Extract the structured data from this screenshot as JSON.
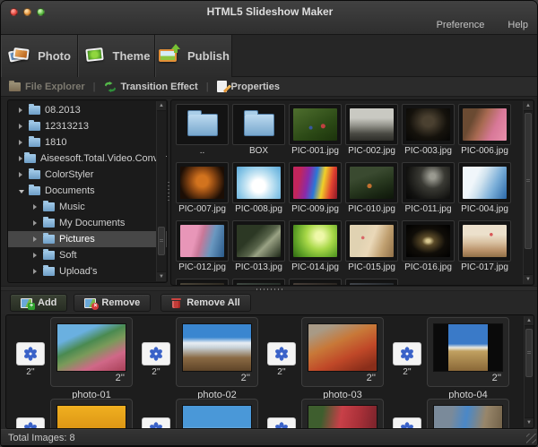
{
  "titlebar": {
    "title": "HTML5 Slideshow Maker",
    "preference": "Preference",
    "help": "Help"
  },
  "tabs": [
    {
      "label": "Photo"
    },
    {
      "label": "Theme"
    },
    {
      "label": "Publish"
    }
  ],
  "toolbar": {
    "file_explorer": "File Explorer",
    "transition_effect": "Transition Effect",
    "properties": "Properties",
    "separator": "|"
  },
  "tree": {
    "items": [
      {
        "label": "08.2013",
        "level": 0,
        "state": "collapsed"
      },
      {
        "label": "12313213",
        "level": 0,
        "state": "collapsed"
      },
      {
        "label": "1810",
        "level": 0,
        "state": "collapsed"
      },
      {
        "label": "Aiseesoft.Total.Video.Converter.P",
        "level": 0,
        "state": "collapsed"
      },
      {
        "label": "ColorStyler",
        "level": 0,
        "state": "collapsed"
      },
      {
        "label": "Documents",
        "level": 0,
        "state": "expanded"
      },
      {
        "label": "Music",
        "level": 1,
        "state": "collapsed"
      },
      {
        "label": "My Documents",
        "level": 1,
        "state": "collapsed"
      },
      {
        "label": "Pictures",
        "level": 1,
        "state": "collapsed",
        "selected": true
      },
      {
        "label": "Soft",
        "level": 1,
        "state": "collapsed"
      },
      {
        "label": "Upload's",
        "level": 1,
        "state": "collapsed"
      }
    ]
  },
  "grid": {
    "items": [
      {
        "type": "folder",
        "label": ".."
      },
      {
        "type": "folder",
        "label": "BOX"
      },
      {
        "type": "image",
        "label": "PIC-001.jpg",
        "art": "background:radial-gradient(circle at 68% 55%,#c04040 0 6%,transparent 7%),radial-gradient(circle at 40% 60%,#3858a0 0 5%,transparent 6%),linear-gradient(150deg,#4e6e2e,#2c4a16 60%,#1c330c)"
      },
      {
        "type": "image",
        "label": "PIC-002.jpg",
        "art": "background:linear-gradient(#c9c9c2 0 30%,#8e8e86 55%,#4a4a44 78%,#2e2e29)"
      },
      {
        "type": "image",
        "label": "PIC-003.jpg",
        "art": "background:radial-gradient(ellipse at 50% 40%,#4a4030 0 18%,#15120c 60%,#060605)"
      },
      {
        "type": "image",
        "label": "PIC-006.jpg",
        "art": "background:linear-gradient(115deg,#6a4a32 0 25%,#a86a52 45%,#d87898 70%,#e890ac)"
      },
      {
        "type": "image",
        "label": "PIC-007.jpg",
        "art": "background:radial-gradient(circle at 50% 45%,#d2731e 0 20%,#8a4612 45%,#1c0e05 80%)"
      },
      {
        "type": "image",
        "label": "PIC-008.jpg",
        "art": "background:radial-gradient(circle at 50% 60%,#ffffff 0 22%,#cfe9f5 40%,#8ec9e8 70%,#5aa8d8)"
      },
      {
        "type": "image",
        "label": "PIC-009.jpg",
        "art": "background:linear-gradient(100deg,#c2255c 0 16%,#8a2aa8 34%,#2a78d8 50%,#f0d028 66%,#e04030 84%,#8a1828)"
      },
      {
        "type": "image",
        "label": "PIC-010.jpg",
        "art": "background:radial-gradient(circle at 45% 60%,#c07030 0 7%,transparent 8%),linear-gradient(160deg,#3a4a30 0 30%,#28381f 55%,#182412 80%,#0e160a)"
      },
      {
        "type": "image",
        "label": "PIC-011.jpg",
        "art": "background:radial-gradient(circle at 60% 30%,#9a9a90 0 8%,#3a3a34 35%,#121210 75%,#060606)"
      },
      {
        "type": "image",
        "label": "PIC-004.jpg",
        "art": "background:linear-gradient(115deg,#f0f6fa 0 30%,#cfe2ee 45%,#7aaed8 70%,#2a68a8)"
      },
      {
        "type": "image",
        "label": "PIC-012.jpg",
        "art": "background:linear-gradient(105deg,#e896b8 0 35%,#c87898 48%,#6a98c0 70%,#2a5a8a)"
      },
      {
        "type": "image",
        "label": "PIC-013.jpg",
        "art": "background:linear-gradient(135deg,#2c3824 0 35%,#58644a 55%,#9aa284 65%,#1c2616)"
      },
      {
        "type": "image",
        "label": "PIC-014.jpg",
        "art": "background:radial-gradient(circle at 60% 35%,#eef8a8 0 12%,#a8d848 40%,#62a428 70%,#2e6812)"
      },
      {
        "type": "image",
        "label": "PIC-015.jpg",
        "art": "background:radial-gradient(circle at 30% 40%,#d86868 0 4%,transparent 5%),linear-gradient(110deg,#e0d2b2 0 30%,#ead8b8 50%,#c0a070 75%,#907048)"
      },
      {
        "type": "image",
        "label": "PIC-016.jpg",
        "art": "background:radial-gradient(ellipse at 50% 50%,#d8c890 0 6%,#5a4a28 20%,#100d08 55%,#000000)"
      },
      {
        "type": "image",
        "label": "PIC-017.jpg",
        "art": "background:radial-gradient(circle at 65% 30%,#d85858 0 4%,transparent 5%),linear-gradient(#ece0cc 0 30%,#d8c0a0 55%,#b89068 80%,#907048)"
      }
    ],
    "partial": [
      {
        "art": "background:linear-gradient(90deg,#4a4438,#2e2a22)"
      },
      {
        "art": "background:linear-gradient(90deg,#3e4640,#262e28)"
      },
      {
        "art": "background:linear-gradient(90deg,#463e38,#2a2622)"
      },
      {
        "art": "background:linear-gradient(90deg,#40444a,#262a2e)"
      }
    ]
  },
  "actions": {
    "add": "Add",
    "remove": "Remove",
    "remove_all": "Remove All"
  },
  "strip": {
    "duration": "2''",
    "photos": [
      {
        "name": "photo-01",
        "art": "background:linear-gradient(155deg,#6ab0e0 0 25%,#4a8a50 42%,#7a9a5a 55%,#d06888 75%,#a84058 100%)"
      },
      {
        "name": "photo-02",
        "art": "background:linear-gradient(#3a86d0 0 28%,#e8eef4 40%,#c8d2d8 50%,#8a6a44 72%,#5e4428)"
      },
      {
        "name": "photo-03",
        "art": "background:linear-gradient(155deg,#a89a86 0 15%,#c87838 40%,#c04828 65%,#8a2e1a 90%)"
      },
      {
        "name": "photo-04",
        "art": "background:linear-gradient(90deg,#0a0a0a 0 21%,transparent 21% 79%,#0a0a0a 79%),linear-gradient(#3a7ac8 0 42%,#e8e8e0 50%,#c0a060 58%,#8a6838 100%)"
      }
    ],
    "partial": [
      {
        "art": "background:linear-gradient(#f0b020,#c87c08)"
      },
      {
        "art": "background:linear-gradient(#4a98d8 0 45%,#b8c8d0 55%,#7a8a5a 75%,#3e4e2e)"
      },
      {
        "art": "background:linear-gradient(100deg,#3e5e2e 0 20%,#c84048 45%,#a83038 70%,#6e2028)"
      },
      {
        "art": "background:linear-gradient(100deg,#7a8a9a 0 25%,#4a88c8 45%,#98866a 70%,#6a5a42)"
      }
    ]
  },
  "status": {
    "total_images": "Total Images: 8"
  }
}
